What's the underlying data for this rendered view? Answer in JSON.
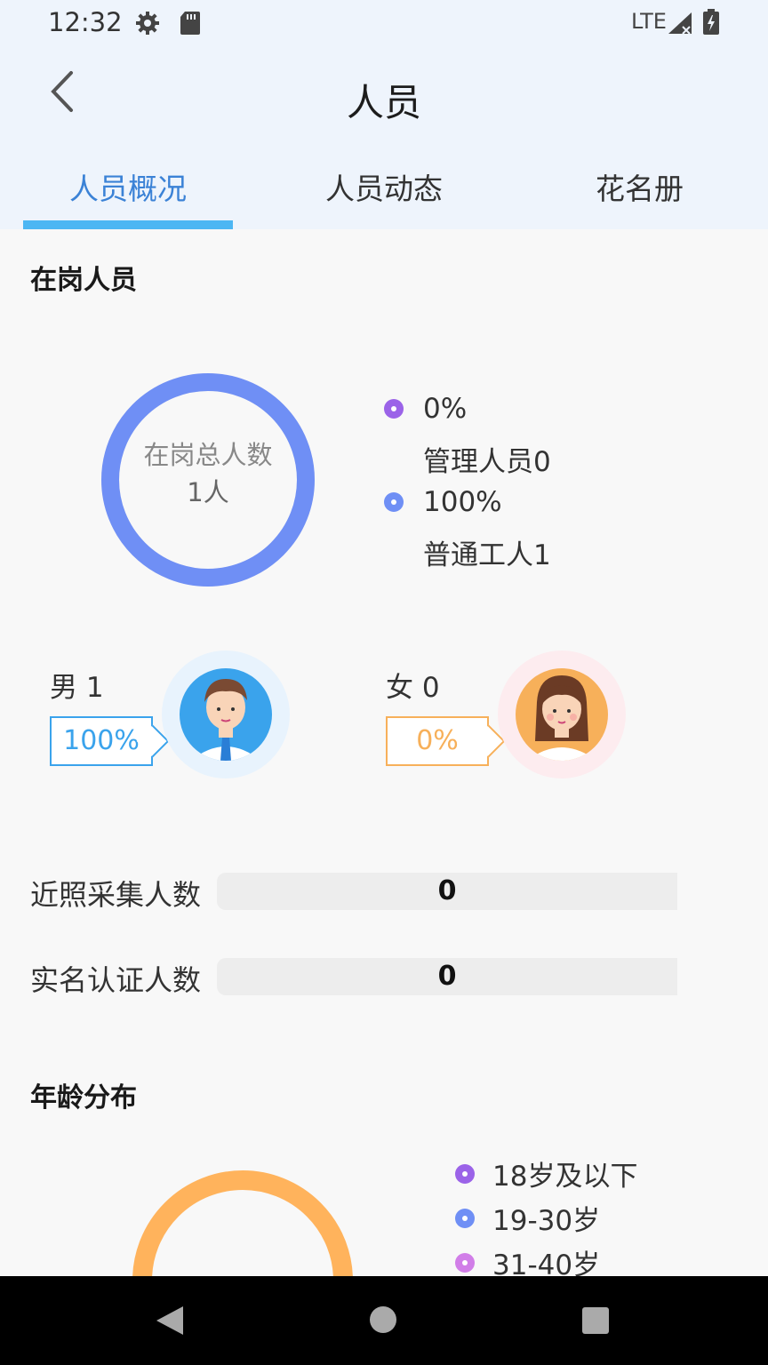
{
  "status_bar": {
    "time": "12:32",
    "network": "LTE"
  },
  "header": {
    "title": "人员"
  },
  "tabs": [
    {
      "label": "人员概况",
      "active": true
    },
    {
      "label": "人员动态",
      "active": false
    },
    {
      "label": "花名册",
      "active": false
    }
  ],
  "on_duty": {
    "section_title": "在岗人员",
    "donut_label": "在岗总人数",
    "donut_value": "1人",
    "legend": [
      {
        "percent": "0%",
        "label": "管理人员0",
        "color": "#9b63e8"
      },
      {
        "percent": "100%",
        "label": "普通工人1",
        "color": "#6f8ff5"
      }
    ],
    "chart_data": {
      "type": "pie",
      "categories": [
        "管理人员",
        "普通工人"
      ],
      "values": [
        0,
        1
      ],
      "colors": [
        "#9b63e8",
        "#6f8ff5"
      ]
    }
  },
  "gender": {
    "male": {
      "label": "男 1",
      "percent": "100%",
      "color": "#3aa3ec"
    },
    "female": {
      "label": "女 0",
      "percent": "0%",
      "color": "#f7b05a"
    }
  },
  "stats": [
    {
      "label": "近照采集人数",
      "value": "0"
    },
    {
      "label": "实名认证人数",
      "value": "0"
    }
  ],
  "age": {
    "section_title": "年龄分布",
    "legend": [
      {
        "label": "18岁及以下",
        "color": "#9b63e8"
      },
      {
        "label": "19-30岁",
        "color": "#6f8ff5"
      },
      {
        "label": "31-40岁",
        "color": "#d17ee8"
      }
    ],
    "ring_color": "#ffb35c"
  }
}
